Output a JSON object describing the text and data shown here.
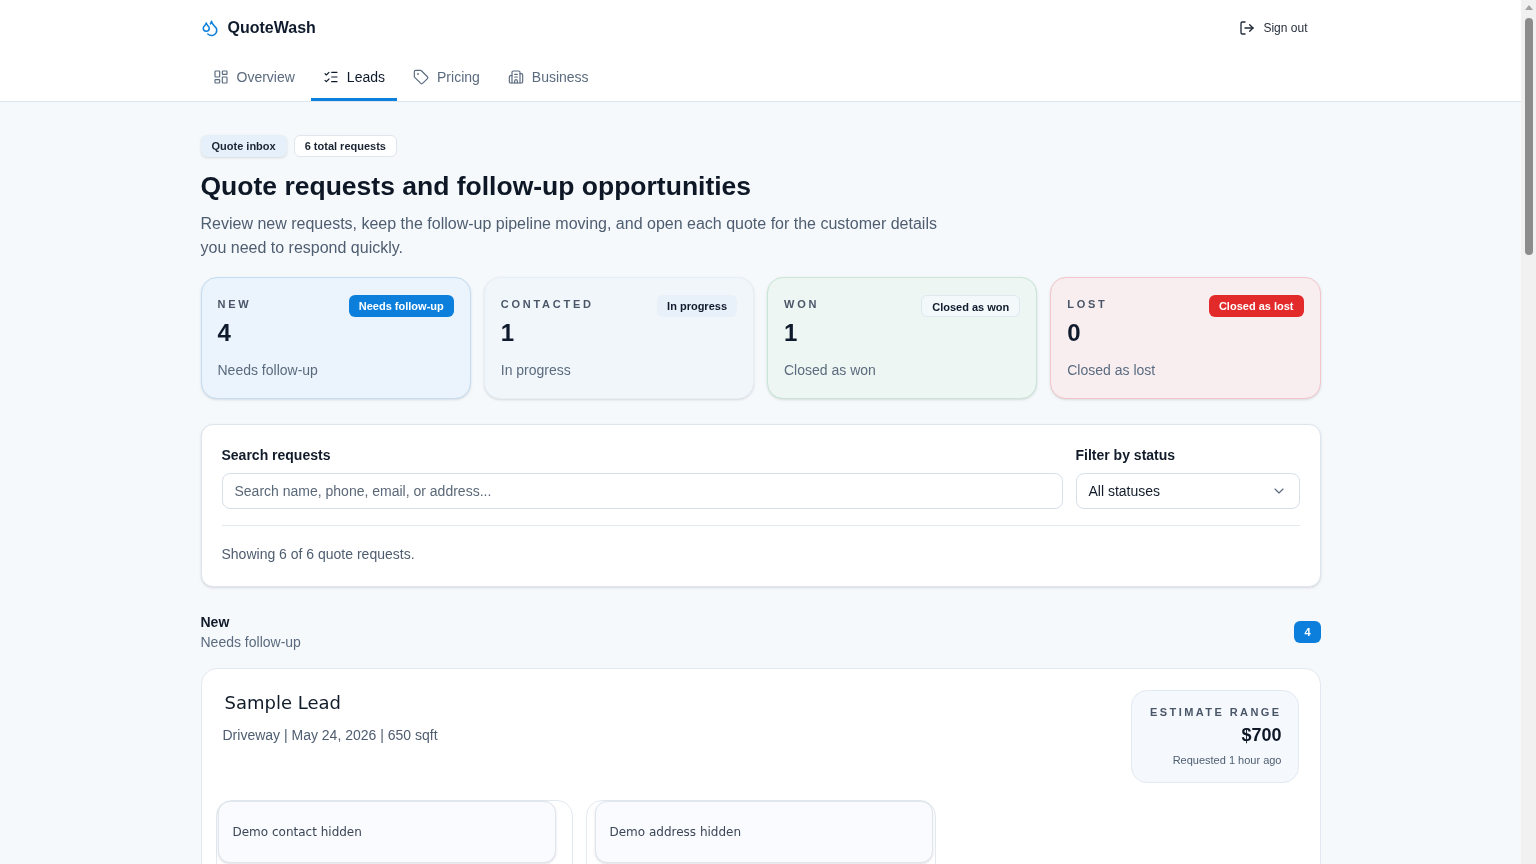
{
  "app": {
    "name": "QuoteWash"
  },
  "sign_out": "Sign out",
  "tabs": [
    {
      "label": "Overview",
      "selected": false
    },
    {
      "label": "Leads",
      "selected": true
    },
    {
      "label": "Pricing",
      "selected": false
    },
    {
      "label": "Business",
      "selected": false
    }
  ],
  "badges": [
    {
      "kind": "filled",
      "text": "Quote inbox"
    },
    {
      "kind": "outline",
      "text": "6 total requests"
    }
  ],
  "title": "Quote requests and follow-up opportunities",
  "description": "Review new requests, keep the follow-up pipeline moving, and open each quote for the customer details you need to respond quickly.",
  "stats": [
    {
      "kind": "new",
      "label": "NEW",
      "badge": "Needs follow-up",
      "count": "4",
      "subtitle": "Needs follow-up"
    },
    {
      "kind": "contacted",
      "label": "CONTACTED",
      "badge": "In progress",
      "count": "1",
      "subtitle": "In progress"
    },
    {
      "kind": "won",
      "label": "WON",
      "badge": "Closed as won",
      "count": "1",
      "subtitle": "Closed as won"
    },
    {
      "kind": "lost",
      "label": "LOST",
      "badge": "Closed as lost",
      "count": "0",
      "subtitle": "Closed as lost"
    }
  ],
  "search": {
    "label": "Search requests",
    "placeholder": "Search name, phone, email, or address..."
  },
  "filter": {
    "label": "Filter by status",
    "value": "All statuses"
  },
  "results_summary": "Showing 6 of 6 quote requests.",
  "sections": [
    {
      "title": "New",
      "subtitle": "Needs follow-up",
      "count": "4",
      "leads": [
        {
          "name": "Sample Lead",
          "details": "Driveway | May 24, 2026 | 650 sqft",
          "estimate_label": "ESTIMATE RANGE",
          "estimate": "$700",
          "requested": "Requested 1 hour ago",
          "info_cards": [
            {
              "kind": "contact",
              "text": "Demo contact hidden"
            },
            {
              "kind": "address",
              "text": "Demo address hidden"
            }
          ]
        }
      ]
    }
  ]
}
